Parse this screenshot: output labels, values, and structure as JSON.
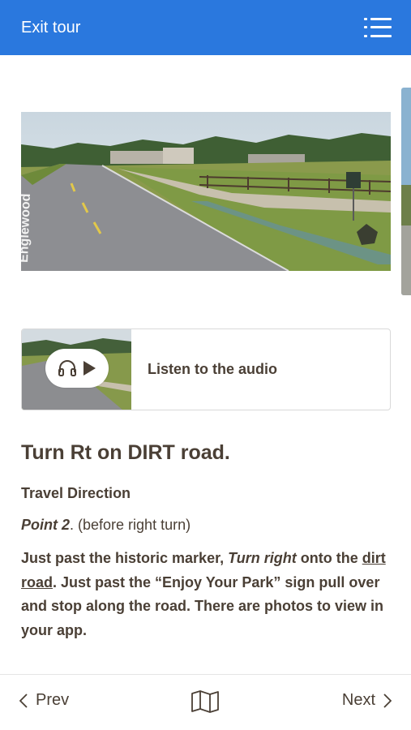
{
  "header": {
    "exit_label": "Exit tour",
    "menu_icon": "list-menu-icon",
    "background": "#2a78de"
  },
  "gallery": {
    "road_sign_text": "Englewood"
  },
  "audio": {
    "label": "Listen to the audio",
    "icons": [
      "headphones-icon",
      "play-icon"
    ]
  },
  "content": {
    "title": "Turn Rt on DIRT road.",
    "subheading": "Travel Direction",
    "point_label": "Point 2",
    "point_suffix": ". (before right turn)",
    "body": {
      "part1": "Just past the historic marker, ",
      "emph1": "Turn right",
      "part2": " onto the ",
      "link": "dirt road",
      "part3": ". Just past the “Enjoy Your Park” sign pull over and stop along the road. There are photos to view in your app."
    }
  },
  "footer": {
    "prev_label": "Prev",
    "next_label": "Next",
    "map_icon": "map-icon"
  },
  "colors": {
    "text": "#4a3f35",
    "accent": "#2a78de"
  }
}
